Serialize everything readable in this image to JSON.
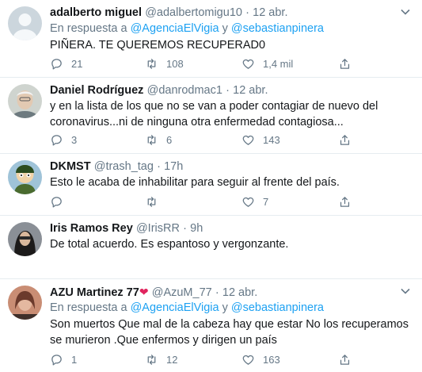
{
  "tweets": [
    {
      "name": "adalberto miguel",
      "handle": "@adalbertomigu10",
      "dot": "·",
      "time": "12 abr.",
      "reply_prefix": "En respuesta a",
      "reply_user1": "@AgenciaElVigia",
      "reply_and": "y",
      "reply_user2": "@sebastianpinera",
      "text": "PIÑERA. TE QUEREMOS RECUPERAD0",
      "replies": "21",
      "retweets": "108",
      "likes": "1,4 mil"
    },
    {
      "name": "Daniel Rodríguez",
      "handle": "@danrodmac1",
      "dot": "·",
      "time": "12 abr.",
      "text": "y en la lista de los que no se van a poder contagiar de nuevo del coronavirus...ni de ninguna otra enfermedad contagiosa...",
      "replies": "3",
      "retweets": "6",
      "likes": "143"
    },
    {
      "name": "DKMST",
      "handle": "@trash_tag",
      "dot": "·",
      "time": "17h",
      "text": "Esto le acaba de inhabilitar para seguir al frente del país.",
      "replies": "",
      "retweets": "",
      "likes": "7"
    },
    {
      "name": "Iris Ramos Rey",
      "handle": "@IrisRR",
      "dot": "·",
      "time": "9h",
      "text": "De total acuerdo. Es espantoso y vergonzante.",
      "replies": "",
      "retweets": "",
      "likes": ""
    },
    {
      "name": "AZU Martinez 77",
      "emoji": "❤",
      "handle": "@AzuM_77",
      "dot": "·",
      "time": "12 abr.",
      "reply_prefix": "En respuesta a",
      "reply_user1": "@AgenciaElVigia",
      "reply_and": "y",
      "reply_user2": "@sebastianpinera",
      "text": "Son muertos Que mal de la cabeza hay que estar  No los recuperamos se murieron .Que enfermos y dirigen un país",
      "replies": "1",
      "retweets": "12",
      "likes": "163"
    }
  ],
  "icons": {
    "reply": "reply-icon",
    "retweet": "retweet-icon",
    "like": "like-icon",
    "share": "share-icon",
    "more": "chevron-down-icon"
  },
  "colors": {
    "link": "#1da1f2",
    "secondary_text": "#657786",
    "divider": "#e6ecf0"
  }
}
